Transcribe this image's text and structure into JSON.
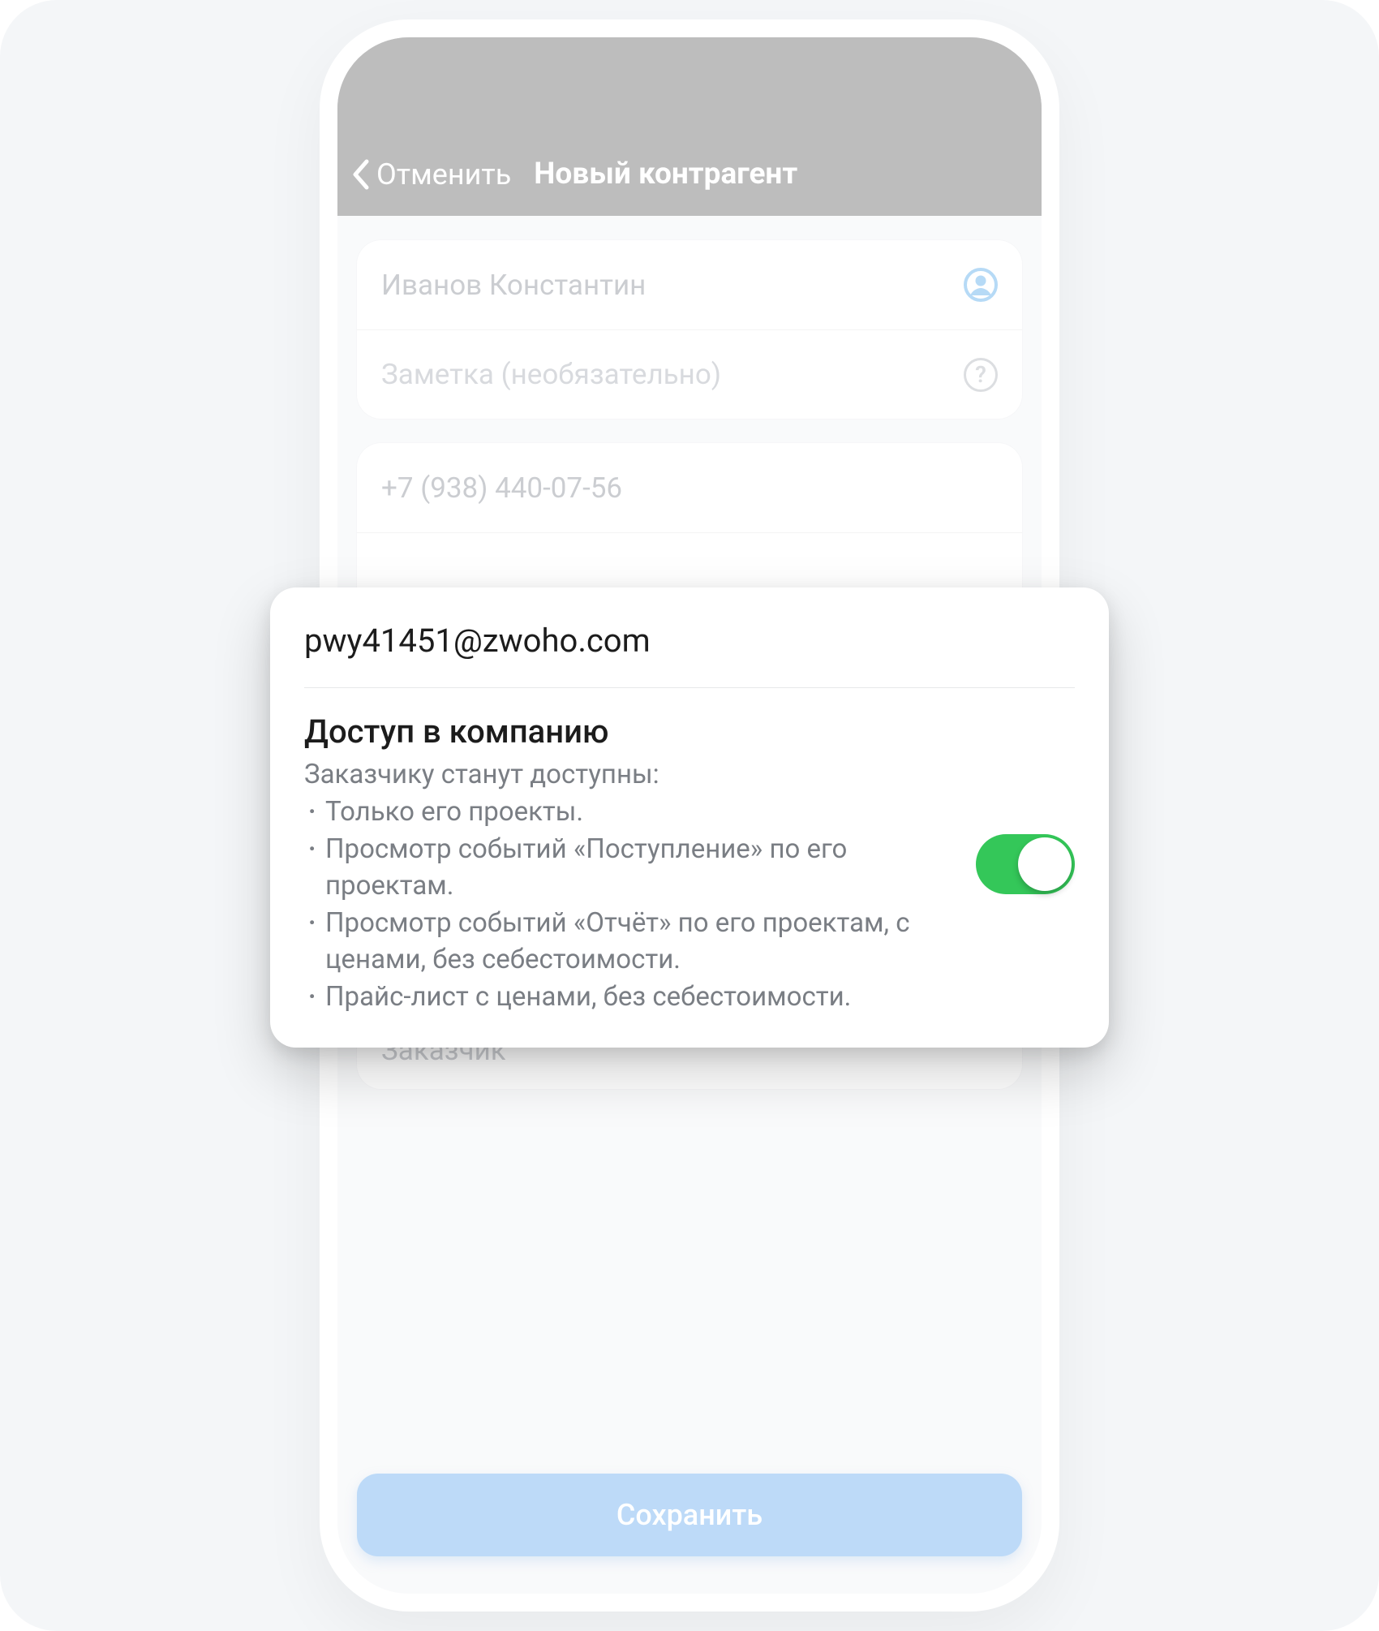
{
  "nav": {
    "back_label": "Отменить",
    "title": "Новый контрагент"
  },
  "form": {
    "name_value": "Иванов Константин",
    "note_placeholder": "Заметка (необязательно)",
    "phone_value": "+7 (938) 440-07-56",
    "category_value": "Заказчик"
  },
  "save_button_label": "Сохранить",
  "popup": {
    "email": "pwy41451@zwoho.com",
    "title": "Доступ в компанию",
    "intro": "Заказчику станут доступны:",
    "bullets": [
      "Только его проекты.",
      "Просмотр событий «Поступление» по его проектам.",
      "Просмотр событий «Отчёт» по его проектам, с ценами, без себестоимости.",
      "Прайс-лист с ценами, без себестоимости."
    ],
    "toggle_on": true,
    "toggle_color_on": "#34C759"
  },
  "colors": {
    "accent_button": "#9AC7F4",
    "navbar": "#9A9A9A"
  }
}
